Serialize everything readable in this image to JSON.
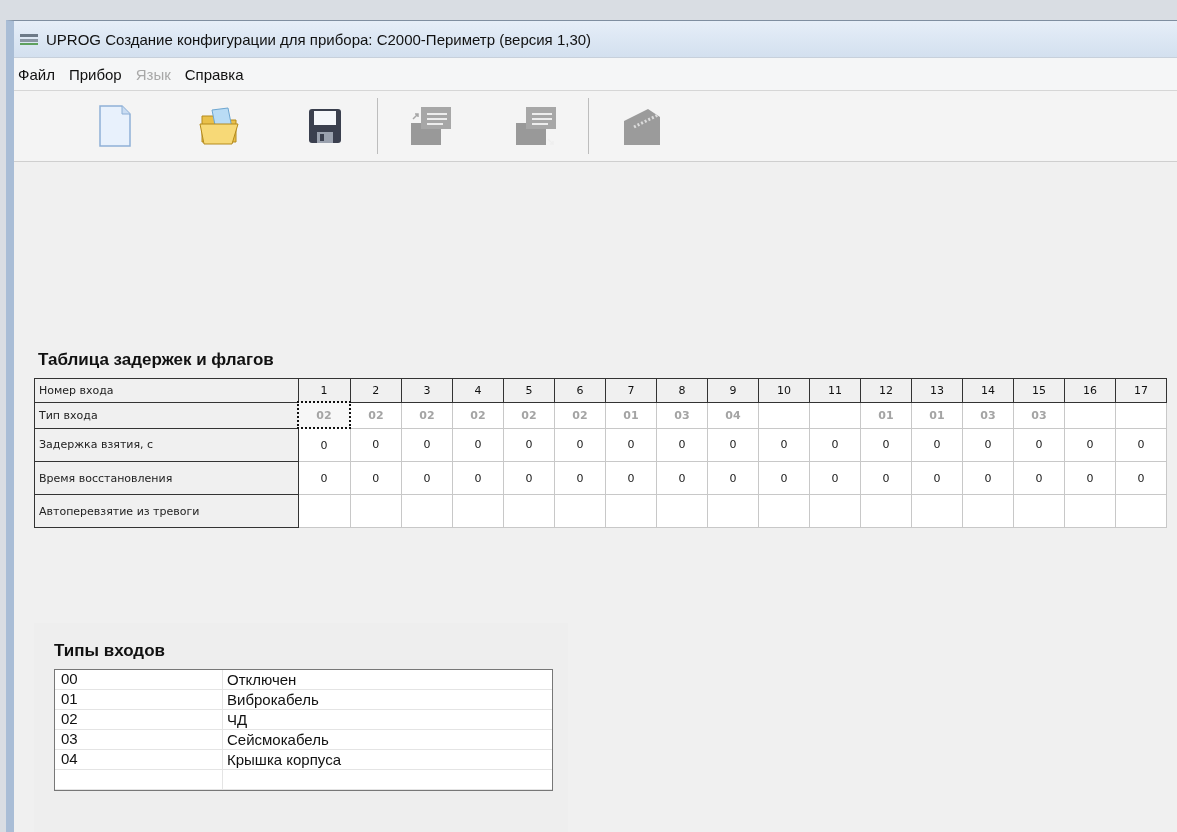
{
  "window": {
    "title": "UPROG  Создание конфигурации для прибора: С2000-Периметр (версия  1,30)"
  },
  "menu": [
    {
      "label": "Файл",
      "disabled": false
    },
    {
      "label": "Прибор",
      "disabled": false
    },
    {
      "label": "Язык",
      "disabled": true
    },
    {
      "label": "Справка",
      "disabled": false
    }
  ],
  "toolbar": [
    {
      "kind": "new",
      "disabled": false
    },
    {
      "kind": "open",
      "disabled": false
    },
    {
      "kind": "save",
      "disabled": false
    },
    {
      "kind": "read",
      "disabled": true
    },
    {
      "kind": "write",
      "disabled": true
    },
    {
      "kind": "device",
      "disabled": true
    }
  ],
  "delays_table": {
    "title": "Таблица задержек и флагов",
    "header": "Номер входа",
    "columns": [
      "1",
      "2",
      "3",
      "4",
      "5",
      "6",
      "7",
      "8",
      "9",
      "10",
      "11",
      "12",
      "13",
      "14",
      "15",
      "16",
      "17"
    ],
    "rows": [
      {
        "kind": "type",
        "label": "Тип входа",
        "cells": [
          {
            "text": "02",
            "focused": true
          },
          {
            "text": "02",
            "focused": false
          },
          {
            "text": "02",
            "focused": false
          },
          {
            "text": "02",
            "focused": false
          },
          {
            "text": "02",
            "focused": false
          },
          {
            "text": "02",
            "focused": false
          },
          {
            "text": "01",
            "focused": false
          },
          {
            "text": "03",
            "focused": false
          },
          {
            "text": "04",
            "focused": false
          },
          null,
          null,
          {
            "text": "01",
            "focused": false
          },
          {
            "text": "01",
            "focused": false
          },
          {
            "text": "03",
            "focused": false
          },
          {
            "text": "03",
            "focused": false
          },
          null,
          null
        ]
      },
      {
        "kind": "value",
        "label": "Задержка взятия, с",
        "cells": [
          "0",
          "0",
          "0",
          "0",
          "0",
          "0",
          "0",
          "0",
          "0",
          "0",
          "0",
          "0",
          "0",
          "0",
          "0",
          "0",
          "0"
        ]
      },
      {
        "kind": "value",
        "label": "Время восстановления",
        "cells": [
          "0",
          "0",
          "0",
          "0",
          "0",
          "0",
          "0",
          "0",
          "0",
          "0",
          "0",
          "0",
          "0",
          "0",
          "0",
          "0",
          "0"
        ]
      },
      {
        "kind": "value",
        "label": "Автоперевзятие из тревоги",
        "cells": [
          null,
          null,
          null,
          null,
          null,
          null,
          null,
          null,
          null,
          null,
          null,
          null,
          null,
          null,
          null,
          null,
          null
        ]
      }
    ]
  },
  "input_types": {
    "title": "Типы входов",
    "items": [
      {
        "code": "00",
        "name": "Отключен"
      },
      {
        "code": "01",
        "name": "Виброкабель"
      },
      {
        "code": "02",
        "name": "ЧД"
      },
      {
        "code": "03",
        "name": "Сейсмокабель"
      },
      {
        "code": "04",
        "name": "Крышка корпуса"
      }
    ]
  }
}
